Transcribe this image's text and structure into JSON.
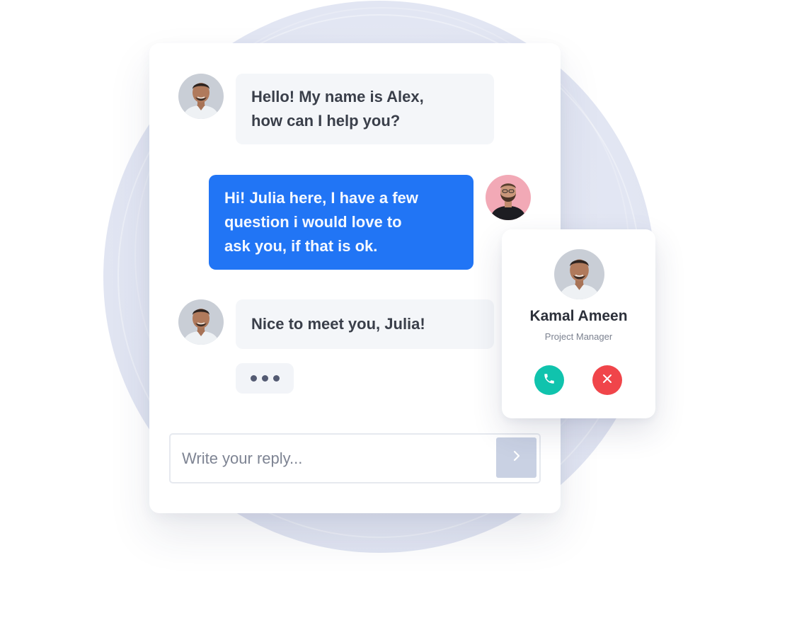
{
  "messages": [
    {
      "sender": "Alex",
      "direction": "incoming",
      "lines": [
        "Hello! My name is Alex,",
        "how can I help you?"
      ]
    },
    {
      "sender": "Julia",
      "direction": "outgoing",
      "lines": [
        "Hi! Julia here, I have a few",
        "question i would love to",
        "ask you, if that is ok."
      ]
    },
    {
      "sender": "Alex",
      "direction": "incoming",
      "lines": [
        "Nice to meet you, Julia!"
      ]
    }
  ],
  "typing_indicator": {
    "dots": 3
  },
  "reply": {
    "placeholder": "Write your reply...",
    "value": "",
    "send_icon": "chevron-right-icon"
  },
  "contact": {
    "name": "Kamal Ameen",
    "role": "Project Manager",
    "accept_icon": "phone-icon",
    "decline_icon": "close-icon"
  },
  "colors": {
    "outgoing_bubble": "#2175f5",
    "incoming_bubble": "#f4f6f9",
    "accept": "#10c3ad",
    "decline": "#f0454a",
    "send_button": "#c9d1e3",
    "background_circle": "#e4e7f4"
  }
}
